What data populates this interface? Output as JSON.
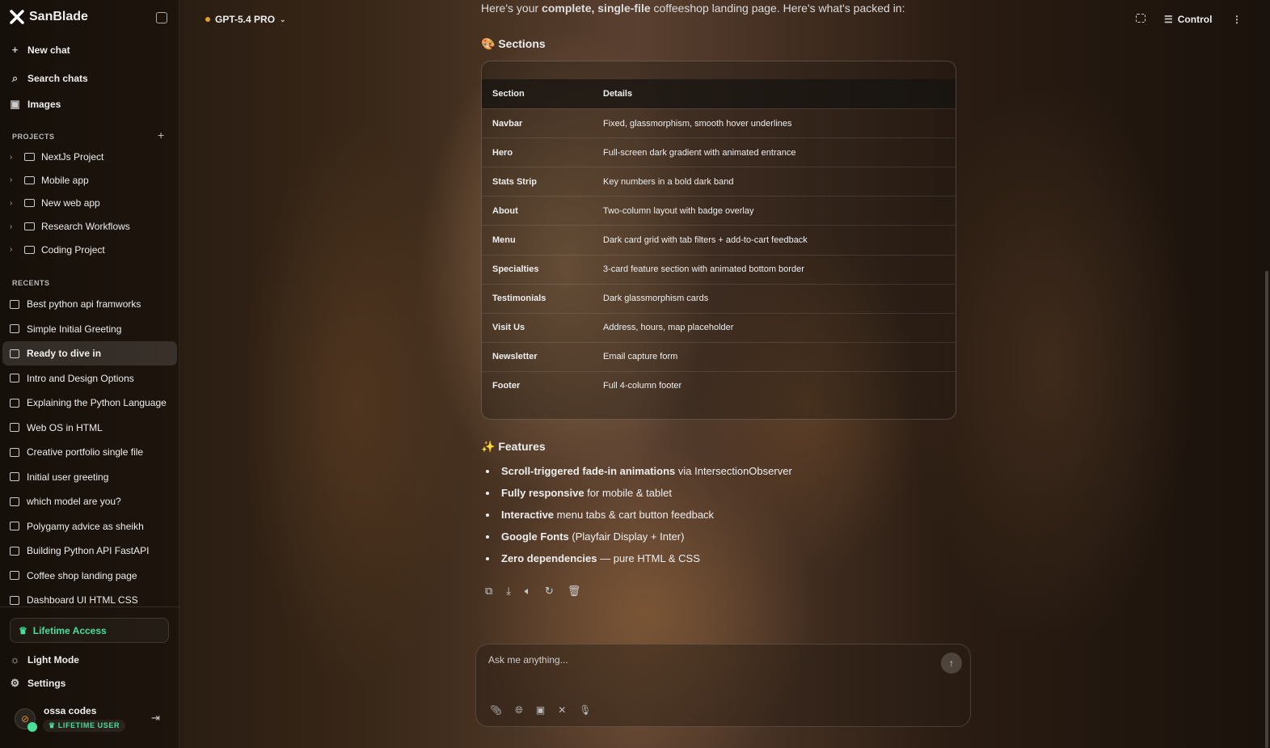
{
  "brand": "SanBlade",
  "sidebar": {
    "nav": [
      {
        "label": "New chat",
        "icon": "plus-icon"
      },
      {
        "label": "Search chats",
        "icon": "search-icon"
      },
      {
        "label": "Images",
        "icon": "image-icon"
      }
    ],
    "projects_label": "PROJECTS",
    "projects": [
      "NextJs Project",
      "Mobile app",
      "New web app",
      "Research Workflows",
      "Coding Project"
    ],
    "recents_label": "RECENTS",
    "recents": [
      "Best python api framworks",
      "Simple Initial Greeting",
      "Ready to dive in",
      "Intro and Design Options",
      "Explaining the Python Language",
      "Web OS in HTML",
      "Creative portfolio single file",
      "Initial user greeting",
      "which model are you?",
      "Polygamy advice as sheikh",
      "Building Python API FastAPI",
      "Coffee shop landing page",
      "Dashboard UI HTML CSS"
    ],
    "active_recent": "Ready to dive in",
    "lifetime": "Lifetime Access",
    "light_mode": "Light Mode",
    "settings": "Settings",
    "user": {
      "name": "ossa codes",
      "badge": "LIFETIME USER"
    }
  },
  "topbar": {
    "model": "GPT-5.4 PRO",
    "control": "Control"
  },
  "message": {
    "intro_pre": "Here's your ",
    "intro_bold": "complete, single-file",
    "intro_post": " coffeeshop landing page. Here's what's packed in:",
    "sections_title": "🎨 Sections",
    "table": {
      "headers": [
        "Section",
        "Details"
      ],
      "rows": [
        [
          "Navbar",
          "Fixed, glassmorphism, smooth hover underlines"
        ],
        [
          "Hero",
          "Full-screen dark gradient with animated entrance"
        ],
        [
          "Stats Strip",
          "Key numbers in a bold dark band"
        ],
        [
          "About",
          "Two-column layout with badge overlay"
        ],
        [
          "Menu",
          "Dark card grid with tab filters + add-to-cart feedback"
        ],
        [
          "Specialties",
          "3-card feature section with animated bottom border"
        ],
        [
          "Testimonials",
          "Dark glassmorphism cards"
        ],
        [
          "Visit Us",
          "Address, hours, map placeholder"
        ],
        [
          "Newsletter",
          "Email capture form"
        ],
        [
          "Footer",
          "Full 4-column footer"
        ]
      ]
    },
    "features_title": "✨ Features",
    "features": [
      {
        "bold": "Scroll-triggered fade-in animations",
        "rest": " via IntersectionObserver"
      },
      {
        "bold": "Fully responsive",
        "rest": " for mobile & tablet"
      },
      {
        "bold": "Interactive",
        "rest": " menu tabs & cart button feedback"
      },
      {
        "bold": "Google Fonts",
        "rest": " (Playfair Display + Inter)"
      },
      {
        "bold": "Zero dependencies",
        "rest": " — pure HTML & CSS"
      }
    ]
  },
  "composer": {
    "placeholder": "Ask me anything..."
  }
}
